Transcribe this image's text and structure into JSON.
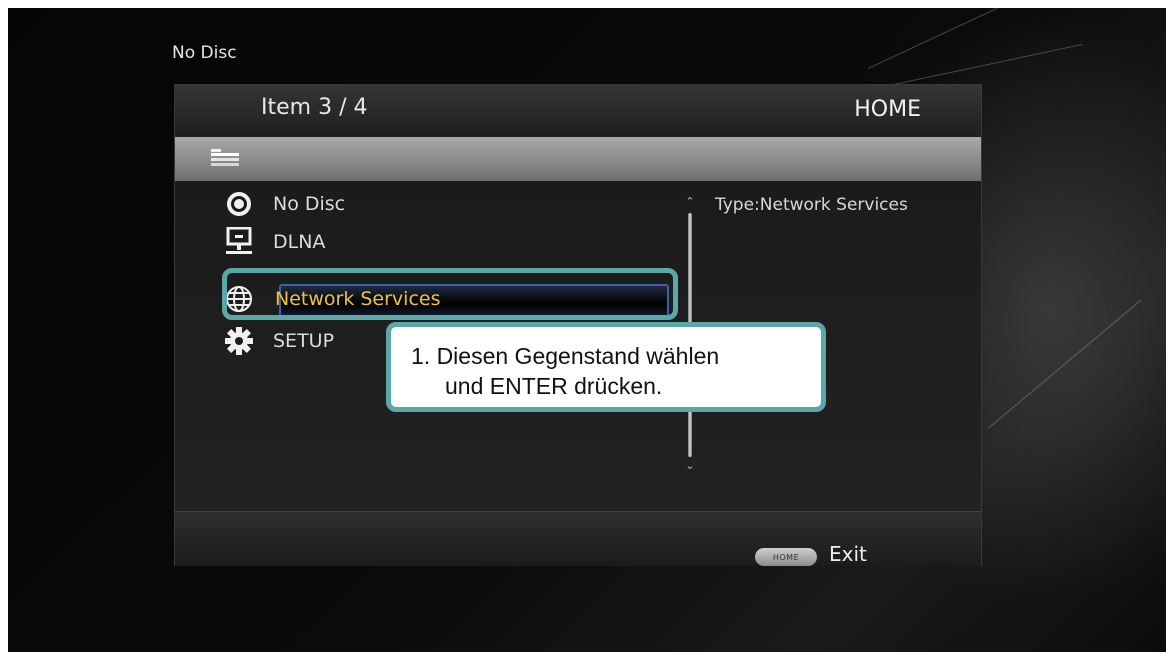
{
  "status": {
    "disc_text": "No Disc"
  },
  "header": {
    "item_counter": "Item 3 / 4",
    "title": "HOME"
  },
  "menu": {
    "items": [
      {
        "label": "No Disc",
        "icon": "disc-icon"
      },
      {
        "label": "DLNA",
        "icon": "network-monitor-icon"
      },
      {
        "label": "Network Services",
        "icon": "globe-icon",
        "selected": true
      },
      {
        "label": "SETUP",
        "icon": "gear-icon"
      }
    ]
  },
  "info": {
    "type_text": "Type:Network Services"
  },
  "footer": {
    "home_button_label": "HOME",
    "exit_label": "Exit"
  },
  "callout": {
    "line1": "1. Diesen Gegenstand wählen",
    "line2": "und ENTER drücken."
  },
  "colors": {
    "highlight_accent": "#5aa9a8",
    "selected_text": "#f1c232",
    "selection_border": "#3d5ea8"
  }
}
